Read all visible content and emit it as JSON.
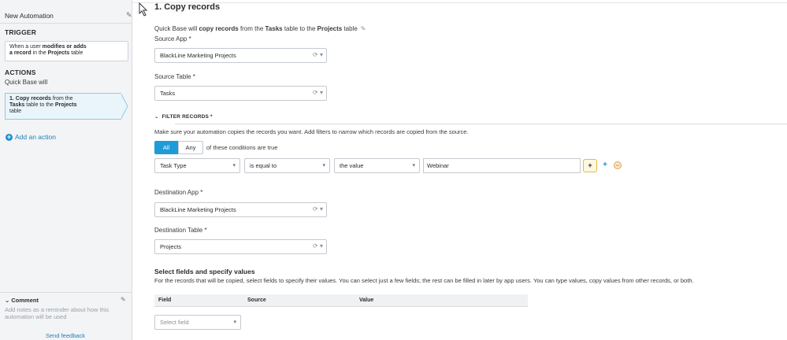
{
  "sidebar": {
    "automation_title": "New Automation",
    "trigger_heading": "TRIGGER",
    "trigger_card": {
      "p1": "When a user ",
      "b1": "modifies or adds",
      "b2": "a record",
      "p2": " in the ",
      "b3": "Projects",
      "p3": " table"
    },
    "actions_heading": "ACTIONS",
    "actions_sub": "Quick Base will",
    "action_card": {
      "b1": "1. Copy records",
      "p1": " from the",
      "b2": "Tasks",
      "p2": " table to the ",
      "b3": "Projects",
      "p3": "table"
    },
    "add_action_label": "Add an action",
    "comment_label": "Comment",
    "comment_placeholder": "Add notes as a reminder about how this automation will be used",
    "send_feedback": "Send feedback"
  },
  "main": {
    "title": "1. Copy records",
    "description": {
      "p1": "Quick Base will ",
      "b1": "copy records",
      "p2": " from the ",
      "b2": "Tasks",
      "p3": " table to the ",
      "b3": "Projects",
      "p4": " table"
    },
    "source_app_label": "Source App *",
    "source_app_value": "BlackLine Marketing Projects",
    "source_table_label": "Source Table *",
    "source_table_value": "Tasks",
    "filter_heading": "FILTER RECORDS *",
    "filter_description": "Make sure your automation copies the records you want. Add filters to narrow which records are copied from the source.",
    "segment_all": "All",
    "segment_any": "Any",
    "conditions_text": "of these conditions are true",
    "filter_row": {
      "field": "Task Type",
      "operator": "is equal to",
      "value_type": "the value",
      "value": "Webinar"
    },
    "dest_app_label": "Destination App *",
    "dest_app_value": "BlackLine Marketing Projects",
    "dest_table_label": "Destination Table *",
    "dest_table_value": "Projects",
    "fields_title": "Select fields and specify values",
    "fields_description": "For the records that will be copied, select fields to specify their values. You can select just a few fields; the rest can be filled in later by app users. You can type values, copy values from other records, or both.",
    "table_headers": [
      "Field",
      "Source",
      "Value"
    ],
    "select_field_placeholder": "Select field"
  },
  "colors": {
    "accent": "#1f9bd7",
    "link": "#1f7fb8",
    "sidebar_bg": "#f3f4f5",
    "action_card_bg": "#e9f5fb"
  }
}
